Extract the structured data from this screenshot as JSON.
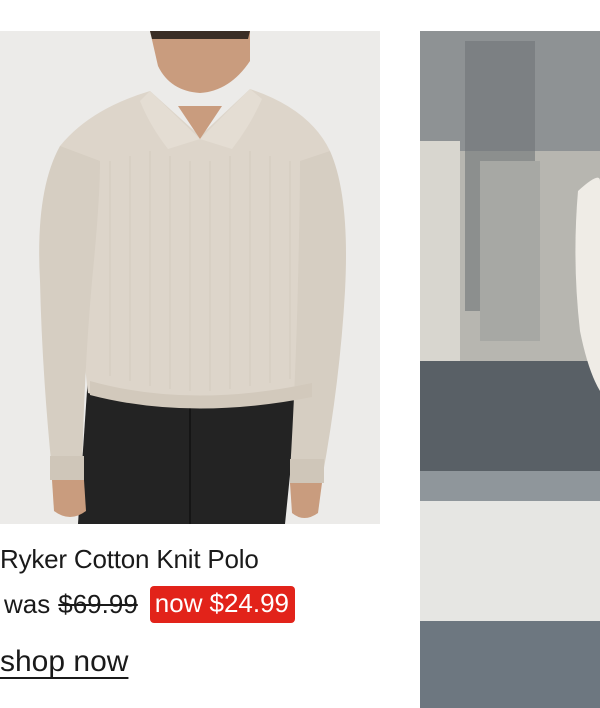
{
  "products": [
    {
      "name": "Ryker Cotton Knit Polo",
      "was_label": "was",
      "old_price": "$69.99",
      "now_label": "now",
      "new_price": "$24.99",
      "cta": "shop now",
      "image": "model-wearing-cream-knit-polo-photo"
    },
    {
      "image": "street-photo-partial"
    }
  ],
  "colors": {
    "sale_badge": "#e2231a",
    "text": "#1a1a1a",
    "image_bg": "#ecebe9"
  }
}
